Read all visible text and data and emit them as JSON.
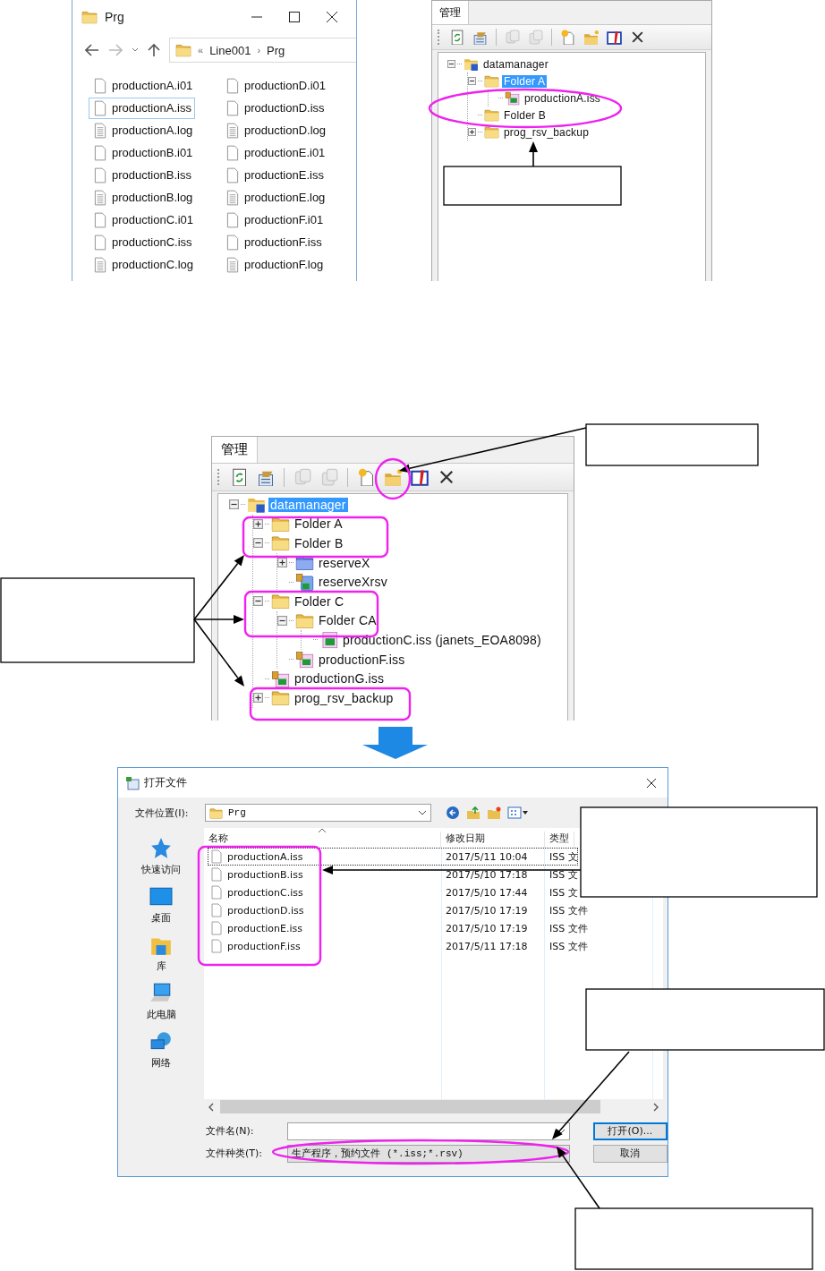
{
  "explorer": {
    "title": "Prg",
    "address": {
      "overflow": "«",
      "parts": [
        "Line001",
        "Prg"
      ],
      "separator": "›"
    },
    "files": [
      {
        "name": "productionA.i01",
        "kind": "blank",
        "selected": false
      },
      {
        "name": "productionA.iss",
        "kind": "blank",
        "selected": true
      },
      {
        "name": "productionA.log",
        "kind": "text",
        "selected": false
      },
      {
        "name": "productionB.i01",
        "kind": "blank",
        "selected": false
      },
      {
        "name": "productionB.iss",
        "kind": "blank",
        "selected": false
      },
      {
        "name": "productionB.log",
        "kind": "text",
        "selected": false
      },
      {
        "name": "productionC.i01",
        "kind": "blank",
        "selected": false
      },
      {
        "name": "productionC.iss",
        "kind": "blank",
        "selected": false
      },
      {
        "name": "productionC.log",
        "kind": "text",
        "selected": false
      },
      {
        "name": "productionD.i01",
        "kind": "blank",
        "selected": false
      },
      {
        "name": "productionD.iss",
        "kind": "blank",
        "selected": false
      },
      {
        "name": "productionD.log",
        "kind": "text",
        "selected": false
      },
      {
        "name": "productionE.i01",
        "kind": "blank",
        "selected": false
      },
      {
        "name": "productionE.iss",
        "kind": "blank",
        "selected": false
      },
      {
        "name": "productionE.log",
        "kind": "text",
        "selected": false
      },
      {
        "name": "productionF.i01",
        "kind": "blank",
        "selected": false
      },
      {
        "name": "productionF.iss",
        "kind": "blank",
        "selected": false
      },
      {
        "name": "productionF.log",
        "kind": "text",
        "selected": false
      }
    ]
  },
  "tree_top": {
    "tab": "管理",
    "toolbar": [
      {
        "kind": "refresh",
        "disabled": false
      },
      {
        "kind": "properties",
        "disabled": false
      },
      {
        "kind": "separator"
      },
      {
        "kind": "copy",
        "disabled": true
      },
      {
        "kind": "paste",
        "disabled": true
      },
      {
        "kind": "separator"
      },
      {
        "kind": "new-file",
        "disabled": false
      },
      {
        "kind": "new-folder",
        "disabled": false
      },
      {
        "kind": "edit",
        "disabled": false
      },
      {
        "kind": "delete",
        "disabled": false
      }
    ],
    "nodes": [
      {
        "label": "datamanager",
        "kind": "root",
        "expanded": true,
        "selected": false,
        "children": [
          {
            "label": "Folder A",
            "kind": "folder",
            "expanded": true,
            "selected": true,
            "children": [
              {
                "label": "productionA.iss",
                "kind": "iss",
                "selected": false
              }
            ]
          },
          {
            "label": "Folder B",
            "kind": "folder",
            "selected": false
          },
          {
            "label": "prog_rsv_backup",
            "kind": "folder",
            "expanded": false,
            "selected": false
          }
        ]
      }
    ]
  },
  "tree_middle": {
    "tab": "管理",
    "toolbar": [
      {
        "kind": "refresh",
        "disabled": false
      },
      {
        "kind": "properties",
        "disabled": false
      },
      {
        "kind": "separator"
      },
      {
        "kind": "copy",
        "disabled": true
      },
      {
        "kind": "paste",
        "disabled": true
      },
      {
        "kind": "separator"
      },
      {
        "kind": "new-file",
        "disabled": false
      },
      {
        "kind": "new-folder",
        "disabled": false
      },
      {
        "kind": "edit",
        "disabled": false
      },
      {
        "kind": "delete",
        "disabled": false
      }
    ],
    "nodes": [
      {
        "label": "datamanager",
        "kind": "root",
        "expanded": true,
        "selected": true,
        "children": [
          {
            "label": "Folder A",
            "kind": "folder",
            "expanded": false,
            "selected": false
          },
          {
            "label": "Folder B",
            "kind": "folder",
            "expanded": true,
            "selected": false,
            "children": [
              {
                "label": "reserveX",
                "kind": "reserve-folder",
                "expanded": false,
                "selected": false
              },
              {
                "label": "reserveXrsv",
                "kind": "rsv",
                "selected": false
              }
            ]
          },
          {
            "label": "Folder C",
            "kind": "folder",
            "expanded": true,
            "selected": false,
            "children": [
              {
                "label": "Folder CA",
                "kind": "folder",
                "expanded": true,
                "selected": false,
                "children": [
                  {
                    "label": "productionC.iss (janets_EOA8098)",
                    "kind": "iss-pink",
                    "selected": false
                  }
                ]
              },
              {
                "label": "productionF.iss",
                "kind": "iss",
                "selected": false
              }
            ]
          },
          {
            "label": "productionG.iss",
            "kind": "iss",
            "selected": false
          },
          {
            "label": "prog_rsv_backup",
            "kind": "folder",
            "expanded": false,
            "selected": false
          }
        ]
      }
    ]
  },
  "dialog": {
    "title": "打开文件",
    "location_label": "文件位置(I):",
    "location_value": "Prg",
    "places": [
      {
        "label": "快速访问",
        "kind": "star"
      },
      {
        "label": "桌面",
        "kind": "desktop"
      },
      {
        "label": "库",
        "kind": "library"
      },
      {
        "label": "此电脑",
        "kind": "computer"
      },
      {
        "label": "网络",
        "kind": "network"
      }
    ],
    "columns": [
      "名称",
      "修改日期",
      "类型"
    ],
    "rows": [
      {
        "name": "productionA.iss",
        "date": "2017/5/11 10:04",
        "type": "ISS 文",
        "selected": true
      },
      {
        "name": "productionB.iss",
        "date": "2017/5/10 17:18",
        "type": "ISS 文",
        "selected": false
      },
      {
        "name": "productionC.iss",
        "date": "2017/5/10 17:44",
        "type": "ISS 文",
        "selected": false
      },
      {
        "name": "productionD.iss",
        "date": "2017/5/10 17:19",
        "type": "ISS 文件",
        "selected": false
      },
      {
        "name": "productionE.iss",
        "date": "2017/5/10 17:19",
        "type": "ISS 文件",
        "selected": false
      },
      {
        "name": "productionF.iss",
        "date": "2017/5/11 17:18",
        "type": "ISS 文件",
        "selected": false
      }
    ],
    "filename_label": "文件名(N):",
    "filetype_label": "文件种类(T):",
    "filetype_value": "生产程序，预约文件 (*.iss;*.rsv)",
    "buttons": [
      {
        "label": "打开(O)...",
        "default": true
      },
      {
        "label": "取消",
        "default": false
      }
    ]
  }
}
